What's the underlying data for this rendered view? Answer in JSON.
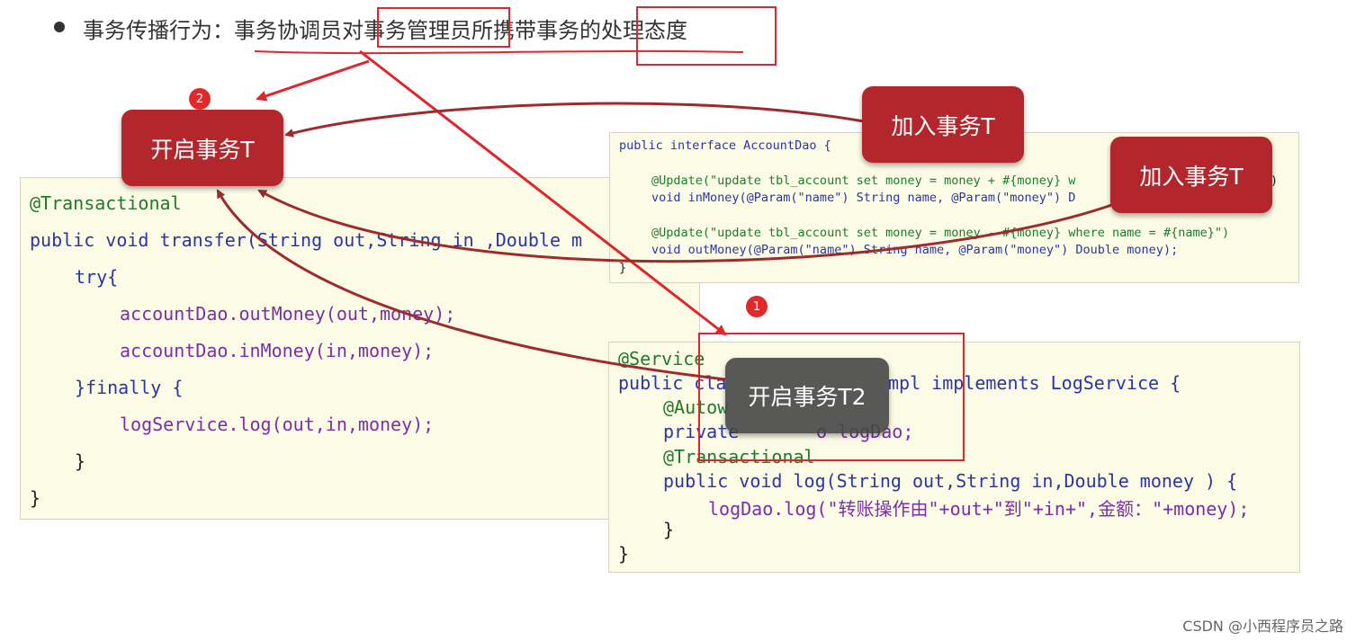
{
  "headline": {
    "prefix": "事务传播行为：",
    "part1": "事务协调员对",
    "part2": "事务管理员",
    "part3": "所携带事务的",
    "part4": "处理态度"
  },
  "main_code": {
    "annotation": "@Transactional",
    "lines": [
      "public void transfer(String out,String in ,Double m",
      "try{",
      "accountDao.outMoney(out,money);",
      "accountDao.inMoney(in,money);",
      "}finally {",
      "logService.log(out,in,money);",
      "}",
      "}"
    ]
  },
  "dao_code": {
    "lines": [
      "public interface AccountDao {",
      "@Update(\"update tbl_account set money = money + #{money} w",
      "void inMoney(@Param(\"name\") String name, @Param(\"money\") D",
      "@Update(\"update tbl_account set money = money - #{money} where name = #{name}\")",
      "void outMoney(@Param(\"name\") String name, @Param(\"money\") Double money);",
      "}"
    ],
    "tail1": ")"
  },
  "log_code": {
    "lines": [
      "@Service",
      "public cla",
      "mpl implements LogService {",
      "@Autow",
      "private",
      "o logDao;",
      "@Transactional",
      "public void log(String out,String in,Double money ) {",
      "logDao.log(\"转账操作由\"+out+\"到\"+in+\",金额：\"+money);",
      "}",
      "}"
    ]
  },
  "bubbles": {
    "start_t": "开启事务T",
    "join_t_1": "加入事务T",
    "join_t_2": "加入事务T",
    "start_t2": "开启事务T2"
  },
  "badges": {
    "one": "1",
    "two": "2"
  },
  "watermark": "CSDN @小西程序员之路",
  "colors": {
    "accent_red": "#e0262c",
    "bubble_red": "#b3262c",
    "arrow_dark": "#9e2a2b",
    "code_bg": "#fbfbe6"
  }
}
